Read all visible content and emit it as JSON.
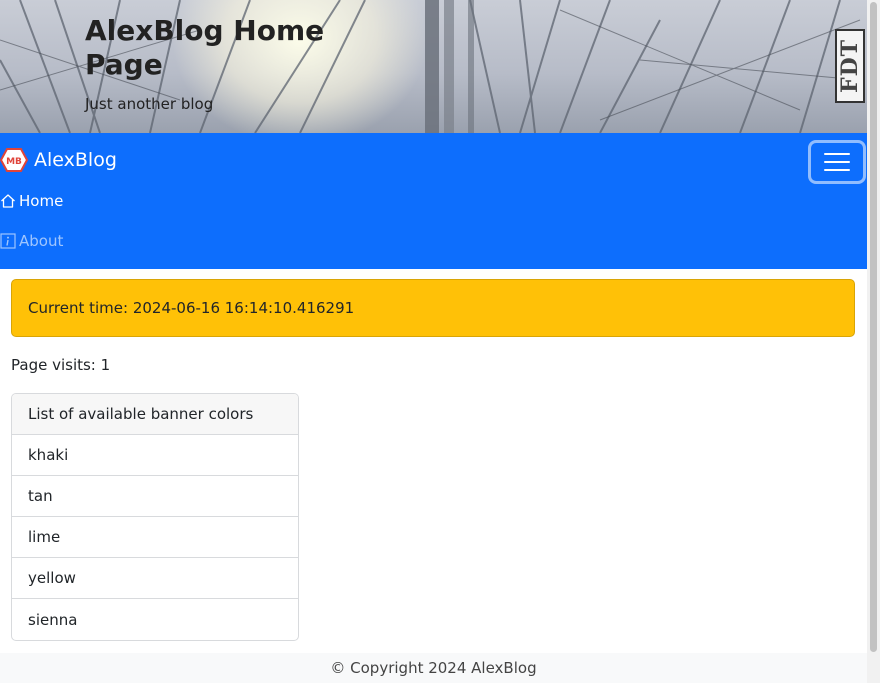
{
  "hero": {
    "title": "AlexBlog Home Page",
    "subtitle": "Just another blog",
    "badge": "FDT"
  },
  "navbar": {
    "brand_logo": "MB",
    "brand": "AlexBlog",
    "toggler_icon": "hamburger-icon",
    "links": [
      {
        "icon": "house-icon",
        "label": "Home"
      },
      {
        "icon": "info-icon",
        "label": "About"
      }
    ],
    "color": "#0d6efd"
  },
  "alert": {
    "text": "Current time: 2024-06-16 16:14:10.416291",
    "color": "#ffc107"
  },
  "visits": "Page visits: 1",
  "banner_colors": {
    "header": "List of available banner colors",
    "items": [
      "khaki",
      "tan",
      "lime",
      "yellow",
      "sienna"
    ]
  },
  "footer": {
    "text": "© Copyright 2024 AlexBlog"
  }
}
